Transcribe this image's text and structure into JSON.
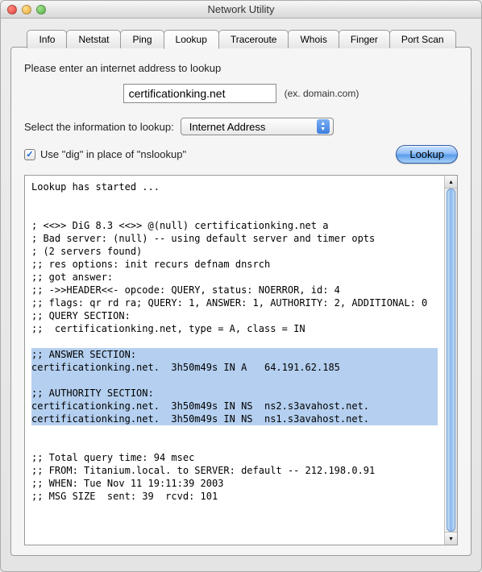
{
  "window_title": "Network Utility",
  "tabs": [
    "Info",
    "Netstat",
    "Ping",
    "Lookup",
    "Traceroute",
    "Whois",
    "Finger",
    "Port Scan"
  ],
  "active_tab_index": 3,
  "prompt_label": "Please enter an internet address to lookup",
  "address_value": "certificationking.net",
  "address_hint": "(ex. domain.com)",
  "select_label": "Select the information to lookup:",
  "select_value": "Internet Address",
  "checkbox_checked": true,
  "checkbox_label": "Use \"dig\" in place of \"nslookup\"",
  "lookup_button": "Lookup",
  "output": {
    "pre1": "Lookup has started ...\n\n\n; <<>> DiG 8.3 <<>> @(null) certificationking.net a\n; Bad server: (null) -- using default server and timer opts\n; (2 servers found)\n;; res options: init recurs defnam dnsrch\n;; got answer:\n;; ->>HEADER<<- opcode: QUERY, status: NOERROR, id: 4\n;; flags: qr rd ra; QUERY: 1, ANSWER: 1, AUTHORITY: 2, ADDITIONAL: 0\n;; QUERY SECTION:\n;;  certificationking.net, type = A, class = IN\n",
    "hl": ";; ANSWER SECTION:\ncertificationking.net.  3h50m49s IN A   64.191.62.185\n\n;; AUTHORITY SECTION:\ncertificationking.net.  3h50m49s IN NS  ns2.s3avahost.net.\ncertificationking.net.  3h50m49s IN NS  ns1.s3avahost.net.",
    "post": "\n;; Total query time: 94 msec\n;; FROM: Titanium.local. to SERVER: default -- 212.198.0.91\n;; WHEN: Tue Nov 11 19:11:39 2003\n;; MSG SIZE  sent: 39  rcvd: 101\n"
  }
}
